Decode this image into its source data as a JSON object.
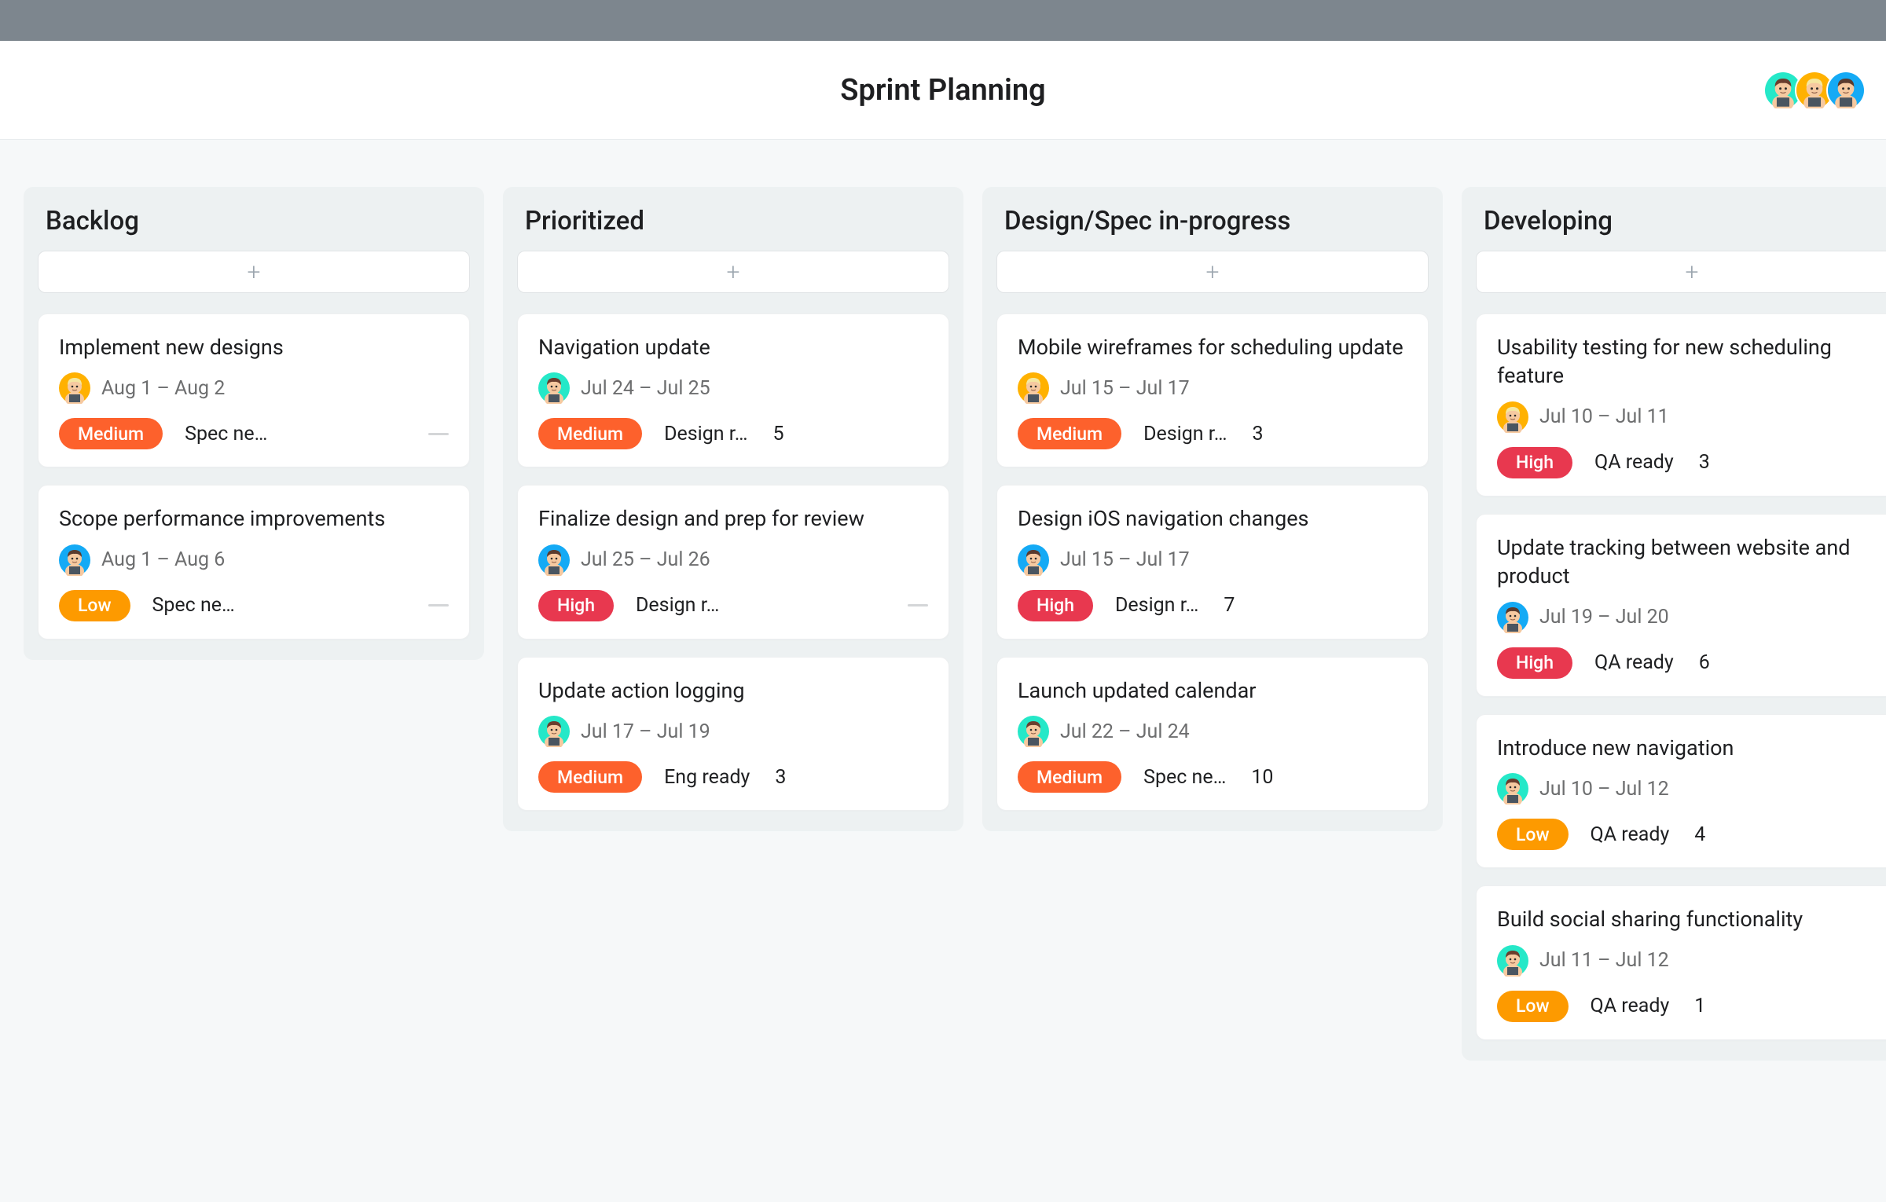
{
  "header": {
    "title": "Sprint Planning",
    "avatars": [
      "green",
      "orange",
      "blue"
    ]
  },
  "priority_labels": {
    "medium": "Medium",
    "high": "High",
    "low": "Low"
  },
  "columns": [
    {
      "title": "Backlog",
      "cards": [
        {
          "title": "Implement new designs",
          "avatar": "orange",
          "date": "Aug 1 – Aug 2",
          "priority": "medium",
          "status": "Spec ne…",
          "count": null,
          "dash": true
        },
        {
          "title": "Scope performance improvements",
          "avatar": "blue",
          "date": "Aug 1 – Aug 6",
          "priority": "low",
          "status": "Spec ne…",
          "count": null,
          "dash": true
        }
      ]
    },
    {
      "title": "Prioritized",
      "cards": [
        {
          "title": "Navigation update",
          "avatar": "green",
          "date": "Jul 24 – Jul 25",
          "priority": "medium",
          "status": "Design r…",
          "count": "5",
          "dash": false
        },
        {
          "title": "Finalize design and prep for review",
          "avatar": "blue",
          "date": "Jul 25 – Jul 26",
          "priority": "high",
          "status": "Design r…",
          "count": null,
          "dash": true
        },
        {
          "title": "Update action logging",
          "avatar": "green",
          "date": "Jul 17 – Jul 19",
          "priority": "medium",
          "status": "Eng ready",
          "count": "3",
          "dash": false
        }
      ]
    },
    {
      "title": "Design/Spec in-progress",
      "cards": [
        {
          "title": "Mobile wireframes for scheduling update",
          "avatar": "orange",
          "date": "Jul 15 – Jul 17",
          "priority": "medium",
          "status": "Design r…",
          "count": "3",
          "dash": false
        },
        {
          "title": "Design iOS navigation changes",
          "avatar": "blue",
          "date": "Jul 15 – Jul 17",
          "priority": "high",
          "status": "Design r…",
          "count": "7",
          "dash": false
        },
        {
          "title": "Launch updated calendar",
          "avatar": "green",
          "date": "Jul 22 – Jul 24",
          "priority": "medium",
          "status": "Spec ne…",
          "count": "10",
          "dash": false
        }
      ]
    },
    {
      "title": "Developing",
      "cards": [
        {
          "title": "Usability testing for new scheduling feature",
          "avatar": "orange",
          "date": "Jul 10 – Jul 11",
          "priority": "high",
          "status": "QA ready",
          "count": "3",
          "dash": false
        },
        {
          "title": "Update tracking between website and product",
          "avatar": "blue",
          "date": "Jul 19 – Jul 20",
          "priority": "high",
          "status": "QA ready",
          "count": "6",
          "dash": false
        },
        {
          "title": "Introduce new navigation",
          "avatar": "green",
          "date": "Jul 10 – Jul 12",
          "priority": "low",
          "status": "QA ready",
          "count": "4",
          "dash": false
        },
        {
          "title": "Build social sharing functionality",
          "avatar": "green",
          "date": "Jul 11 – Jul 12",
          "priority": "low",
          "status": "QA ready",
          "count": "1",
          "dash": false
        }
      ]
    }
  ]
}
